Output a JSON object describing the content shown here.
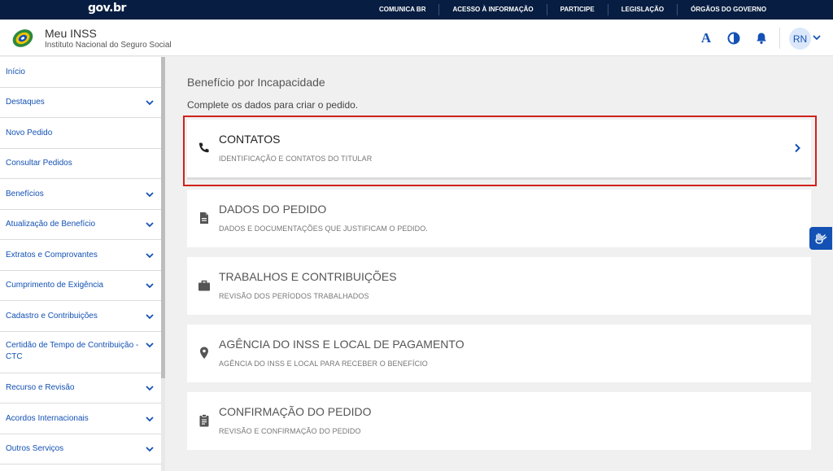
{
  "govbar": {
    "logo": "gov.br",
    "links": [
      "COMUNICA BR",
      "ACESSO À INFORMAÇÃO",
      "PARTICIPE",
      "LEGISLAÇÃO",
      "ÓRGÃOS DO GOVERNO"
    ]
  },
  "header": {
    "title": "Meu INSS",
    "subtitle": "Instituto Nacional do Seguro Social",
    "font_button": "A",
    "avatar_initials": "RN"
  },
  "sidebar": {
    "items": [
      {
        "label": "Início",
        "has_submenu": false
      },
      {
        "label": "Destaques",
        "has_submenu": true
      },
      {
        "label": "Novo Pedido",
        "has_submenu": false
      },
      {
        "label": "Consultar Pedidos",
        "has_submenu": false
      },
      {
        "label": "Benefícios",
        "has_submenu": true
      },
      {
        "label": "Atualização de Benefício",
        "has_submenu": true
      },
      {
        "label": "Extratos e Comprovantes",
        "has_submenu": true
      },
      {
        "label": "Cumprimento de Exigência",
        "has_submenu": true
      },
      {
        "label": "Cadastro e Contribuições",
        "has_submenu": true
      },
      {
        "label": "Certidão de Tempo de Contribuição - CTC",
        "has_submenu": true
      },
      {
        "label": "Recurso e Revisão",
        "has_submenu": true
      },
      {
        "label": "Acordos Internacionais",
        "has_submenu": true
      },
      {
        "label": "Outros Serviços",
        "has_submenu": true
      }
    ]
  },
  "main": {
    "title": "Benefício por Incapacidade",
    "subtitle": "Complete os dados para criar o pedido.",
    "steps": [
      {
        "title": "CONTATOS",
        "description": "IDENTIFICAÇÃO E CONTATOS DO TITULAR",
        "icon": "phone-icon",
        "active": true
      },
      {
        "title": "DADOS DO PEDIDO",
        "description": "DADOS E DOCUMENTAÇÕES QUE JUSTIFICAM O PEDIDO.",
        "icon": "document-icon",
        "active": false
      },
      {
        "title": "TRABALHOS E CONTRIBUIÇÕES",
        "description": "REVISÃO DOS PERÍODOS TRABALHADOS",
        "icon": "briefcase-icon",
        "active": false
      },
      {
        "title": "AGÊNCIA DO INSS E LOCAL DE PAGAMENTO",
        "description": "AGÊNCIA DO INSS E LOCAL PARA RECEBER O BENEFÍCIO",
        "icon": "location-pin-icon",
        "active": false
      },
      {
        "title": "CONFIRMAÇÃO DO PEDIDO",
        "description": "REVISÃO E CONFIRMAÇÃO DO PEDIDO",
        "icon": "clipboard-icon",
        "active": false
      }
    ]
  },
  "colors": {
    "govbar_bg": "#071d41",
    "primary_blue": "#1351b4",
    "highlight_red": "#d0221c"
  }
}
